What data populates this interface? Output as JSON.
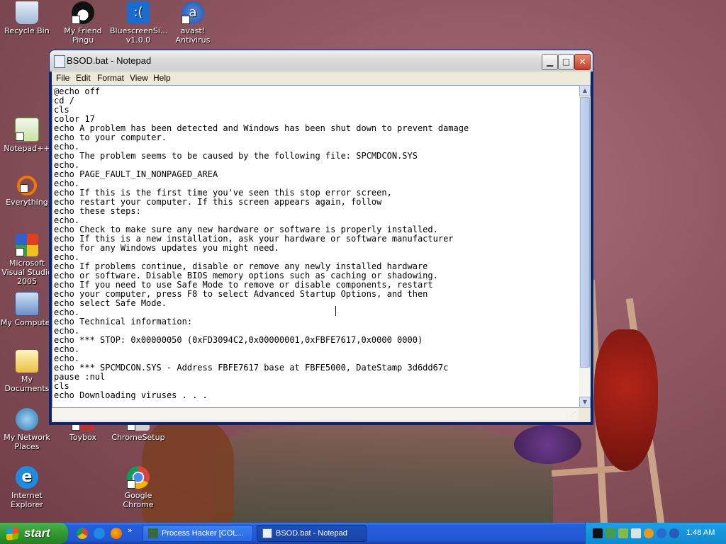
{
  "desktop": {
    "icons": [
      {
        "label": "Recycle Bin"
      },
      {
        "label": "My Friend Pingu"
      },
      {
        "label": "BluescreenSi... v1.0.0"
      },
      {
        "label": "avast! Antivirus"
      },
      {
        "label": "Notepad++"
      },
      {
        "label": "Everything"
      },
      {
        "label": "Microsoft Visual Studio 2005"
      },
      {
        "label": "My Computer"
      },
      {
        "label": "My Documents"
      },
      {
        "label": "My Network Places"
      },
      {
        "label": "Toybox"
      },
      {
        "label": "ChromeSetup"
      },
      {
        "label": "Internet Explorer"
      },
      {
        "label": "Google Chrome"
      }
    ]
  },
  "window": {
    "title": "BSOD.bat - Notepad",
    "menu": [
      "File",
      "Edit",
      "Format",
      "View",
      "Help"
    ],
    "content": "@echo off\ncd /\ncls\ncolor 17\necho A problem has been detected and Windows has been shut down to prevent damage\necho to your computer.\necho.\necho The problem seems to be caused by the following file: SPCMDCON.SYS\necho.\necho PAGE_FAULT_IN_NONPAGED_AREA\necho.\necho If this is the first time you've seen this stop error screen,\necho restart your computer. If this screen appears again, follow\necho these steps:\necho.\necho Check to make sure any new hardware or software is properly installed.\necho If this is a new installation, ask your hardware or software manufacturer\necho for any Windows updates you might need.\necho.\necho If problems continue, disable or remove any newly installed hardware\necho or software. Disable BIOS memory options such as caching or shadowing.\necho If you need to use Safe Mode to remove or disable components, restart\necho your computer, press F8 to select Advanced Startup Options, and then\necho select Safe Mode.\necho.\necho Technical information:\necho.\necho *** STOP: 0x00000050 (0xFD3094C2,0x00000001,0xFBFE7617,0x0000 0000)\necho.\necho.\necho *** SPCMDCON.SYS - Address FBFE7617 base at FBFE5000, DateStamp 3d6dd67c\npause :nul\ncls\necho Downloading viruses . . ."
  },
  "taskbar": {
    "start_label": "start",
    "tasks": [
      {
        "label": "Process Hacker [COL..."
      },
      {
        "label": "BSOD.bat - Notepad"
      }
    ],
    "clock": "1:48 AM"
  },
  "colors": {
    "taskbar_blue": "#245edb",
    "start_green": "#319a2f",
    "close_red": "#c2402a"
  }
}
